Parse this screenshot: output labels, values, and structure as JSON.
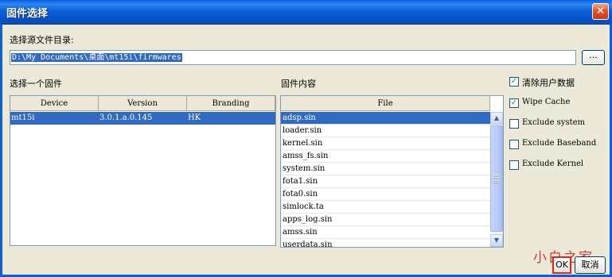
{
  "window": {
    "title": "固件选择",
    "close_label": "✕"
  },
  "source_dir": {
    "label": "选择源文件目录:",
    "value": "D:\\My Documents\\桌面\\mt15i\\firmwares",
    "browse_label": "..."
  },
  "firmware_section": {
    "label": "选择一个固件"
  },
  "firmware_table": {
    "columns": [
      "Device",
      "Version",
      "Branding"
    ],
    "rows": [
      {
        "device": "mt15i",
        "version": "3.0.1.a.0.145",
        "branding": "HK",
        "selected": true
      }
    ]
  },
  "content_section": {
    "label": "固件内容"
  },
  "file_list": {
    "column": "File",
    "items": [
      "adsp.sin",
      "loader.sin",
      "kernel.sin",
      "amss_fs.sin",
      "system.sin",
      "fota1.sin",
      "fota0.sin",
      "simlock.ta",
      "apps_log.sin",
      "amss.sin",
      "userdata.sin"
    ],
    "selected_index": 0
  },
  "options": [
    {
      "label": "清除用户数据",
      "checked": true
    },
    {
      "label": "Wipe Cache",
      "checked": true
    },
    {
      "label": "Exclude system",
      "checked": false
    },
    {
      "label": "Exclude Baseband",
      "checked": false
    },
    {
      "label": "Exclude Kernel",
      "checked": false
    }
  ],
  "buttons": {
    "ok": "OK",
    "cancel": "取消"
  },
  "watermark": "小白之家",
  "colors": {
    "selection": "#316ac5",
    "titlebar": "#0a5fd8",
    "highlight_box": "#d6281b"
  }
}
